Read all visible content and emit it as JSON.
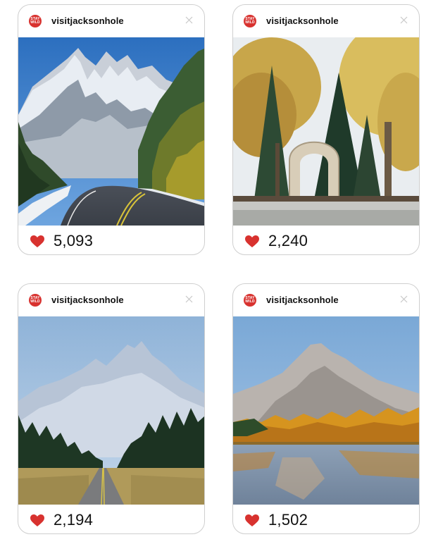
{
  "posts": [
    {
      "username": "visitjacksonhole",
      "avatar_text": "STAY WILD",
      "likes": "5,093",
      "photo_icon": "photo-mountain-road",
      "accent": "#d8322f"
    },
    {
      "username": "visitjacksonhole",
      "avatar_text": "STAY WILD",
      "likes": "2,240",
      "photo_icon": "photo-antler-arch",
      "accent": "#d8322f"
    },
    {
      "username": "visitjacksonhole",
      "avatar_text": "STAY WILD",
      "likes": "2,194",
      "photo_icon": "photo-teton-highway",
      "accent": "#d8322f"
    },
    {
      "username": "visitjacksonhole",
      "avatar_text": "STAY WILD",
      "likes": "1,502",
      "photo_icon": "photo-mountain-lake",
      "accent": "#d8322f"
    }
  ]
}
